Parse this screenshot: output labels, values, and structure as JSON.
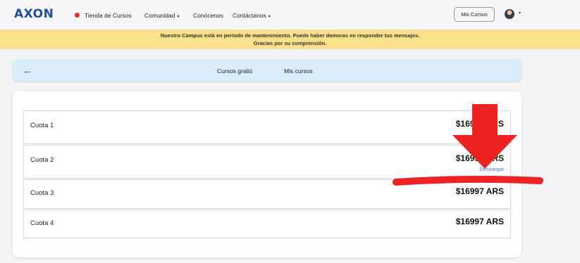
{
  "header": {
    "logo": "AXON",
    "nav": [
      {
        "label": "Tienda de Cursos"
      },
      {
        "label": "Comunidad",
        "caret": "▾"
      },
      {
        "label": "Conócenos"
      },
      {
        "label": "Contáctanos",
        "caret": "▾"
      }
    ],
    "mis_cursos_button": "Mis Cursos",
    "avatar_caret": "▾"
  },
  "banner": {
    "line1": "Nuestro Campus está en periodo de mantenimiento. Puede haber demoras en responder tus mensajes.",
    "line2": "Gracias por su comprensión."
  },
  "subnav": {
    "back_icon": "←",
    "links": [
      {
        "label": "Cursos gratis"
      },
      {
        "label": "Mis cursos"
      }
    ]
  },
  "cuotas": [
    {
      "label": "Cuota 1",
      "amount": "$16997 ARS"
    },
    {
      "label": "Cuota 2",
      "amount": "$16997 ARS",
      "link": "Descargar"
    },
    {
      "label": "Cuota 3",
      "amount": "$16997 ARS"
    },
    {
      "label": "Cuota 4",
      "amount": "$16997 ARS"
    }
  ],
  "colors": {
    "brand": "#1d4f9c",
    "banner": "#f9e08a",
    "subnav": "#d9ecf9",
    "annotation_red": "#ee2222",
    "link": "#3a7bd5"
  }
}
